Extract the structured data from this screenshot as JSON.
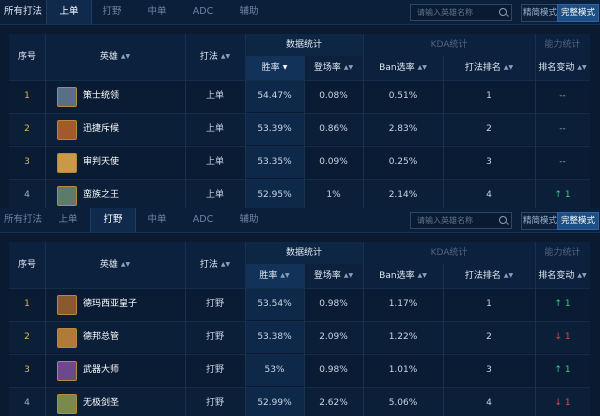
{
  "search_placeholder": "请输入英雄名称",
  "mode_simple": "精简模式",
  "mode_full": "完整模式",
  "panels": [
    {
      "tabs": [
        "所有打法",
        "上单",
        "打野",
        "中单",
        "ADC",
        "辅助"
      ],
      "active_tab": 1,
      "header": {
        "group_stats": "数据统计",
        "group_kda": "KDA统计",
        "group_capability": "能力统计",
        "col_index": "序号",
        "col_hero": "英雄",
        "col_style": "打法",
        "col_winrate": "胜率",
        "col_pickrate": "登场率",
        "col_banrate": "Ban选率",
        "col_style_rank": "打法排名",
        "col_rank_change": "排名变动"
      },
      "rows": [
        {
          "index": "1",
          "hero": "策士统领",
          "style": "上单",
          "winrate": "54.47%",
          "pickrate": "0.08%",
          "banrate": "0.51%",
          "style_rank": "1",
          "change": "--",
          "trend": "none",
          "avatar_color": "#5a6f87"
        },
        {
          "index": "2",
          "hero": "迅捷斥候",
          "style": "上单",
          "winrate": "53.39%",
          "pickrate": "0.86%",
          "banrate": "2.83%",
          "style_rank": "2",
          "change": "--",
          "trend": "none",
          "avatar_color": "#a35a2a"
        },
        {
          "index": "3",
          "hero": "审判天使",
          "style": "上单",
          "winrate": "53.35%",
          "pickrate": "0.09%",
          "banrate": "0.25%",
          "style_rank": "3",
          "change": "--",
          "trend": "none",
          "avatar_color": "#c79a4a"
        },
        {
          "index": "4",
          "hero": "蛮族之王",
          "style": "上单",
          "winrate": "52.95%",
          "pickrate": "1%",
          "banrate": "2.14%",
          "style_rank": "4",
          "change": "↑ 1",
          "trend": "up",
          "avatar_color": "#5d7a6a"
        }
      ]
    },
    {
      "tabs": [
        "所有打法",
        "上单",
        "打野",
        "中单",
        "ADC",
        "辅助"
      ],
      "active_tab": 2,
      "header": {
        "group_stats": "数据统计",
        "group_kda": "KDA统计",
        "group_capability": "能力统计",
        "col_index": "序号",
        "col_hero": "英雄",
        "col_style": "打法",
        "col_winrate": "胜率",
        "col_pickrate": "登场率",
        "col_banrate": "Ban选率",
        "col_style_rank": "打法排名",
        "col_rank_change": "排名变动"
      },
      "rows": [
        {
          "index": "1",
          "hero": "德玛西亚皇子",
          "style": "打野",
          "winrate": "53.54%",
          "pickrate": "0.98%",
          "banrate": "1.17%",
          "style_rank": "1",
          "change": "↑ 1",
          "trend": "up",
          "avatar_color": "#8a5a2e"
        },
        {
          "index": "2",
          "hero": "德邦总管",
          "style": "打野",
          "winrate": "53.38%",
          "pickrate": "2.09%",
          "banrate": "1.22%",
          "style_rank": "2",
          "change": "↓ 1",
          "trend": "down",
          "avatar_color": "#b07a3a"
        },
        {
          "index": "3",
          "hero": "武器大师",
          "style": "打野",
          "winrate": "53%",
          "pickrate": "0.98%",
          "banrate": "1.01%",
          "style_rank": "3",
          "change": "↑ 1",
          "trend": "up",
          "avatar_color": "#6a4a8a"
        },
        {
          "index": "4",
          "hero": "无极剑圣",
          "style": "打野",
          "winrate": "52.99%",
          "pickrate": "2.62%",
          "banrate": "5.06%",
          "style_rank": "4",
          "change": "↓ 1",
          "trend": "down",
          "avatar_color": "#7a8a4a"
        }
      ]
    }
  ]
}
